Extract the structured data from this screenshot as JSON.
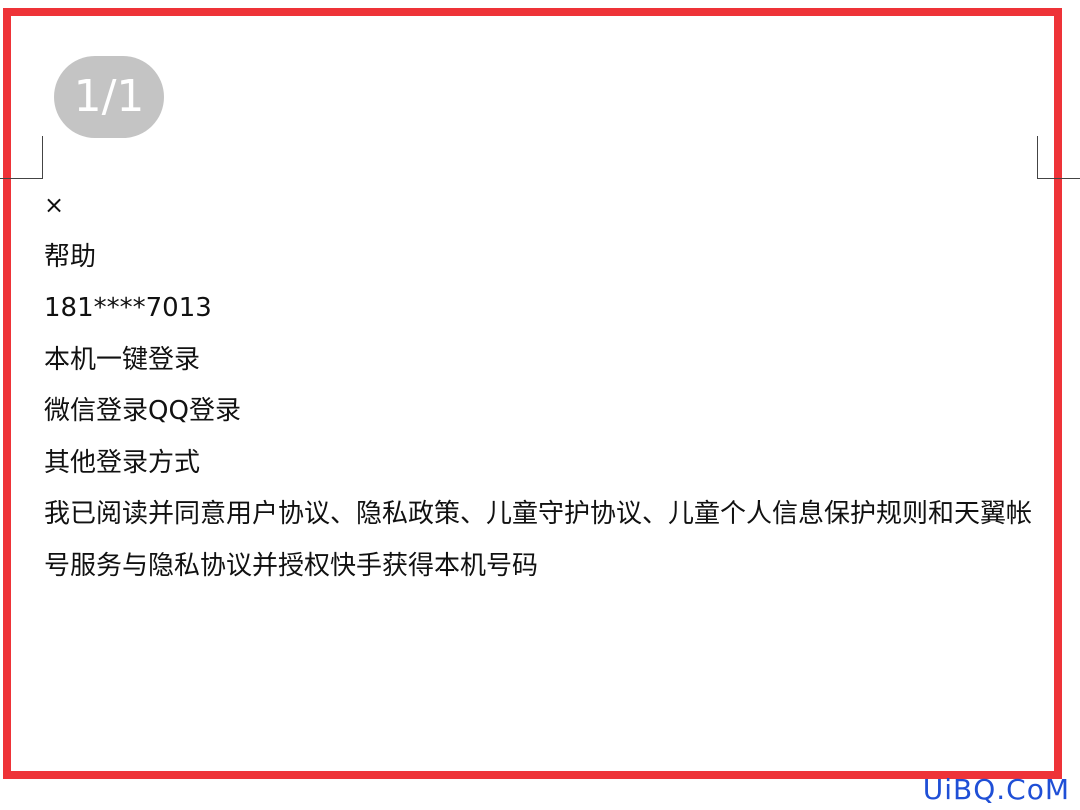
{
  "page_counter": "1/1",
  "close_icon": "×",
  "help_label": "帮助",
  "phone_number": "181****7013",
  "one_click_login_label": "本机一键登录",
  "wechat_login_label": "微信登录",
  "qq_login_label": "QQ登录",
  "other_login_label": "其他登录方式",
  "agreement_text": "我已阅读并同意用户协议、隐私政策、儿童守护协议、儿童个人信息保护规则和天翼帐号服务与隐私协议并授权快手获得本机号码",
  "watermark": "UiBQ.CoM",
  "colors": {
    "frame_border": "#ee3338",
    "counter_bg": "#c4c4c4",
    "watermark": "#1f4fd6"
  }
}
